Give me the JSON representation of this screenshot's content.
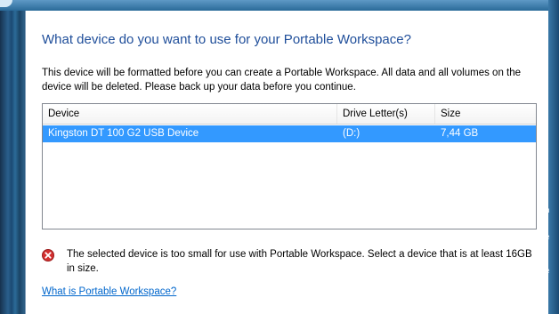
{
  "dialog": {
    "title": "What device do you want to use for your Portable Workspace?",
    "description": "This device will be formatted before you can create a Portable Workspace. All data and all volumes on the device will be deleted. Please back up your data before you continue."
  },
  "device_list": {
    "columns": [
      "Device",
      "Drive Letter(s)",
      "Size"
    ],
    "rows": [
      {
        "device": "Kingston DT 100 G2 USB Device",
        "drive": "(D:)",
        "size": "7,44 GB",
        "selected": true
      }
    ]
  },
  "error": {
    "icon": "error-icon",
    "message": "The selected device is too small for use with Portable Workspace. Select a device that is at least 16GB in size."
  },
  "help_link": "What is Portable Workspace?",
  "colors": {
    "title": "#1f4e9a",
    "selection": "#3399ff",
    "link": "#0066cc",
    "error_red": "#d32f2f"
  }
}
